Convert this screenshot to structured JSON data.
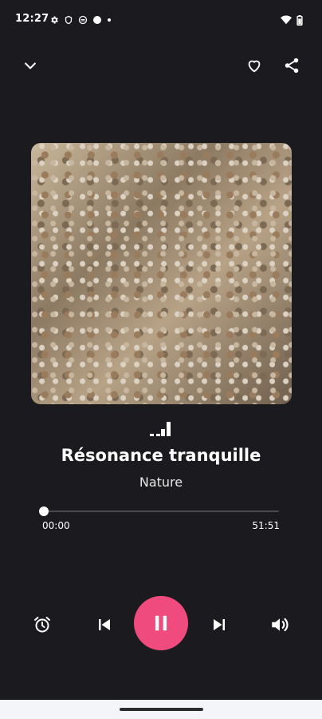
{
  "status_bar": {
    "time": "12:27",
    "left_icons": [
      "gear-icon",
      "shield-icon",
      "sync-icon",
      "dot-icon",
      "small-dot-icon"
    ],
    "right_icons": [
      "wifi-icon",
      "battery-icon"
    ]
  },
  "header": {
    "collapse_icon": "chevron-down-icon",
    "favorite_icon": "heart-icon",
    "share_icon": "share-icon"
  },
  "track": {
    "title": "Résonance tranquille",
    "artist": "Nature",
    "artwork": "pebbles-image"
  },
  "playback": {
    "current_time": "00:00",
    "duration": "51:51",
    "progress": 0.0,
    "state": "playing"
  },
  "controls": {
    "alarm_icon": "alarm-clock-icon",
    "prev_icon": "skip-previous-icon",
    "play_pause_icon": "pause-icon",
    "next_icon": "skip-next-icon",
    "volume_icon": "volume-icon"
  },
  "colors": {
    "background": "#1b1b1f",
    "accent": "#f04b7e",
    "text": "#ffffff"
  }
}
